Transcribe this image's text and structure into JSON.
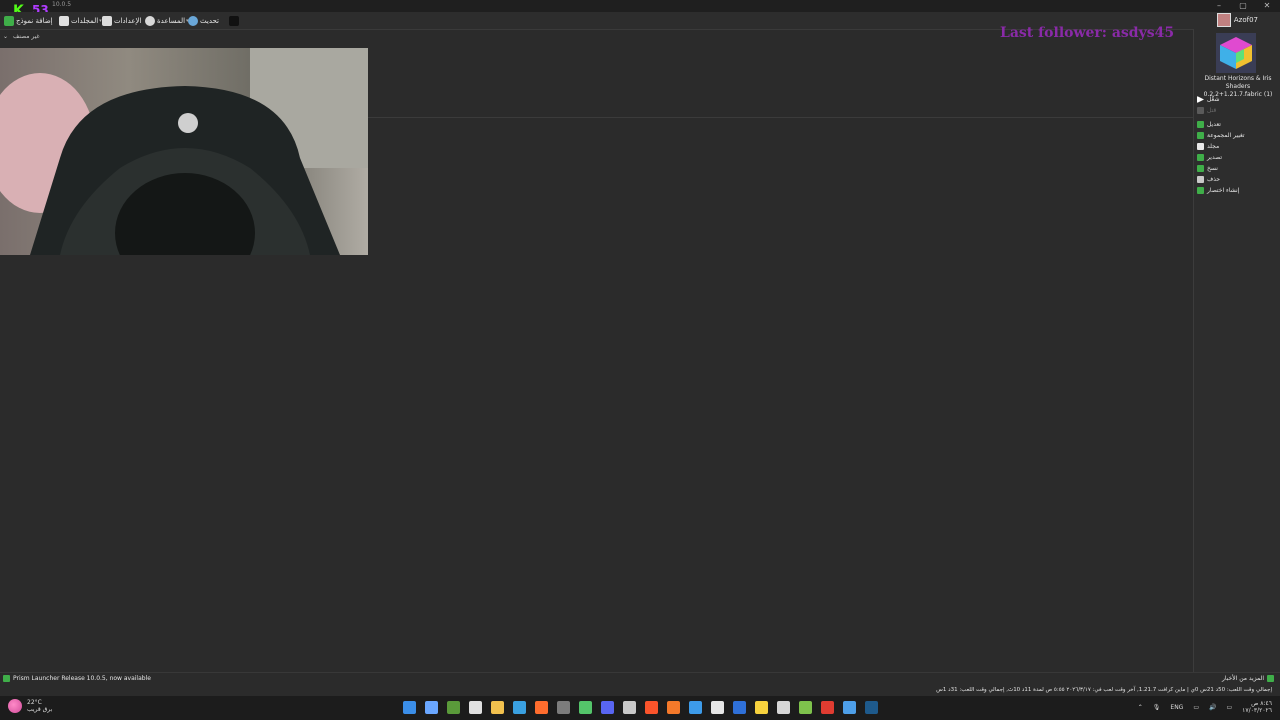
{
  "window": {
    "version": "10.0.5"
  },
  "overlay": {
    "kick_num": "53",
    "follower": "Last follower: asdys45"
  },
  "toolbar": {
    "add_instance": "إضافة نموذج",
    "folders": "المجلدات",
    "settings": "الإعدادات",
    "help": "المساعدة",
    "update": "تحديث",
    "username": "Azof07"
  },
  "group": {
    "label": "غير مصنف"
  },
  "instance": {
    "name": "Distant Horizons & Iris Shaders 0.2.2+1.21.7.fabric (1)",
    "actions": [
      {
        "label": "شغّل",
        "color": "#ffffff",
        "enabled": true
      },
      {
        "label": "قتل",
        "color": "#5a5a5a",
        "enabled": false
      },
      {
        "label": "تعديل",
        "color": "#3fae49",
        "enabled": true
      },
      {
        "label": "تغيير المجموعة",
        "color": "#3fae49",
        "enabled": true
      },
      {
        "label": "مجلد",
        "color": "#e8e8e8",
        "enabled": true
      },
      {
        "label": "تصدير",
        "color": "#3fae49",
        "enabled": true
      },
      {
        "label": "نسخ",
        "color": "#3fae49",
        "enabled": true
      },
      {
        "label": "حذف",
        "color": "#c9c9c9",
        "enabled": true
      },
      {
        "label": "إنشاء اختصار",
        "color": "#3fae49",
        "enabled": true
      }
    ]
  },
  "status": {
    "news_left": "Prism Launcher Release 10.0.5, now available",
    "news_right": "المزيد من الأخبار",
    "playtime": "إجمالي وقت اللعب: 50د 21س 0ي | ماين كرافت 1.21.7, آخر وقت لعب في: ٢٠٢٦/٣/١٧ ٥:٥٥ ص لمدة 11د 10ث, إجمالي وقت اللعب: 31د 1س"
  },
  "taskbar": {
    "temperature": "22°C",
    "weather_desc": "برق قريب",
    "lang": "ENG",
    "time": "٨:٤٦ ص",
    "date": "١٧/٠٣/٢٠٢٦",
    "apps": [
      {
        "name": "start",
        "color": "#3b8ee8"
      },
      {
        "name": "task-view",
        "color": "#6aa7ff"
      },
      {
        "name": "minecraft",
        "color": "#5a9a3a"
      },
      {
        "name": "capcut",
        "color": "#e0e0e0"
      },
      {
        "name": "file-explorer",
        "color": "#f2c14e"
      },
      {
        "name": "edge",
        "color": "#3aa0e0"
      },
      {
        "name": "firefox",
        "color": "#ff6d2e"
      },
      {
        "name": "minecraft-launcher",
        "color": "#7c7c7c"
      },
      {
        "name": "prism",
        "color": "#54c56a"
      },
      {
        "name": "discord",
        "color": "#5865f2"
      },
      {
        "name": "obs",
        "color": "#c9c9c9"
      },
      {
        "name": "brave",
        "color": "#fb542b"
      },
      {
        "name": "blender",
        "color": "#f5792a"
      },
      {
        "name": "vscode",
        "color": "#3d9be9"
      },
      {
        "name": "calculator",
        "color": "#e6e6e6"
      },
      {
        "name": "bitwarden",
        "color": "#2f70d8"
      },
      {
        "name": "sticky-notes",
        "color": "#f7d23e"
      },
      {
        "name": "capture",
        "color": "#d6d6d6"
      },
      {
        "name": "app-green",
        "color": "#7ec24c"
      },
      {
        "name": "acrobat",
        "color": "#e03c31"
      },
      {
        "name": "photos",
        "color": "#4e9fe8"
      },
      {
        "name": "steam",
        "color": "#1e5a8c"
      }
    ]
  }
}
